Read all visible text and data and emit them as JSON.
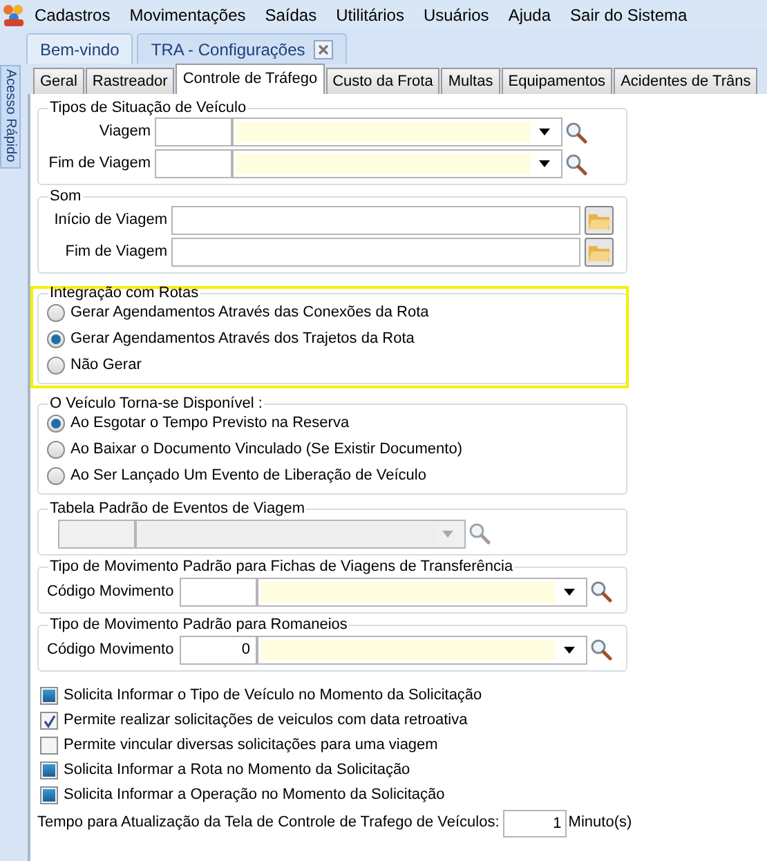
{
  "menu": [
    {
      "label": "Cadastros"
    },
    {
      "label": "Movimentações"
    },
    {
      "label": "Saídas"
    },
    {
      "label": "Utilitários"
    },
    {
      "label": "Usuários"
    },
    {
      "label": "Ajuda"
    },
    {
      "label": "Sair do Sistema"
    }
  ],
  "doc_tabs": [
    {
      "label": "Bem-vindo",
      "selected": false,
      "closable": false
    },
    {
      "label": "TRA - Configurações",
      "selected": true,
      "closable": true
    }
  ],
  "side_panel": {
    "label": "Acesso Rápido"
  },
  "tabs": [
    {
      "label": "Geral",
      "selected": false
    },
    {
      "label": "Rastreador",
      "selected": false
    },
    {
      "label": "Controle de Tráfego",
      "selected": true
    },
    {
      "label": "Custo da Frota",
      "selected": false
    },
    {
      "label": "Multas",
      "selected": false
    },
    {
      "label": "Equipamentos",
      "selected": false
    },
    {
      "label": "Acidentes de Trâns",
      "selected": false
    }
  ],
  "situacao": {
    "title": "Tipos de Situação de Veículo",
    "rows": [
      {
        "label": "Viagem"
      },
      {
        "label": "Fim de Viagem"
      }
    ]
  },
  "som": {
    "title": "Som",
    "rows": [
      {
        "label": "Início de Viagem"
      },
      {
        "label": "Fim de Viagem"
      }
    ]
  },
  "integracao": {
    "title": "Integração com Rotas",
    "highlighted": true,
    "options": [
      {
        "label": "Gerar Agendamentos Através das Conexões da Rota",
        "selected": false
      },
      {
        "label": "Gerar Agendamentos Através dos Trajetos da Rota",
        "selected": true
      },
      {
        "label": "Não Gerar",
        "selected": false
      }
    ]
  },
  "disponivel": {
    "title": "O Veículo Torna-se Disponível :",
    "highlighted": false,
    "options": [
      {
        "label": "Ao Esgotar o Tempo Previsto na Reserva",
        "selected": true
      },
      {
        "label": "Ao Baixar o Documento Vinculado (Se Existir Documento)",
        "selected": false
      },
      {
        "label": "Ao Ser Lançado Um Evento de Liberação de Veículo",
        "selected": false
      }
    ]
  },
  "tabela_eventos": {
    "title": "Tabela Padrão de Eventos de Viagem",
    "disabled": true
  },
  "mov_fichas": {
    "title": "Tipo de Movimento Padrão para Fichas de Viagens de Transferência",
    "label": "Código Movimento",
    "disabled": false
  },
  "mov_romaneios": {
    "title": "Tipo de Movimento Padrão para Romaneios",
    "label": "Código Movimento",
    "value": "0",
    "disabled": false
  },
  "checkboxes": [
    {
      "label": "Solicita Informar o Tipo de Veículo no Momento da Solicitação",
      "checked": false,
      "indeterminate": true
    },
    {
      "label": "Permite realizar solicitações de veiculos com data retroativa",
      "checked": true,
      "indeterminate": false
    },
    {
      "label": "Permite vincular diversas solicitações para uma viagem",
      "checked": false,
      "indeterminate": false
    },
    {
      "label": "Solicita Informar a Rota no Momento da Solicitação",
      "checked": false,
      "indeterminate": true
    },
    {
      "label": "Solicita Informar a Operação no Momento da Solicitação",
      "checked": false,
      "indeterminate": true
    }
  ],
  "refresh": {
    "label": "Tempo para Atualização da Tela de Controle de Trafego de Veículos:",
    "value": "1",
    "unit": "Minuto(s)"
  }
}
